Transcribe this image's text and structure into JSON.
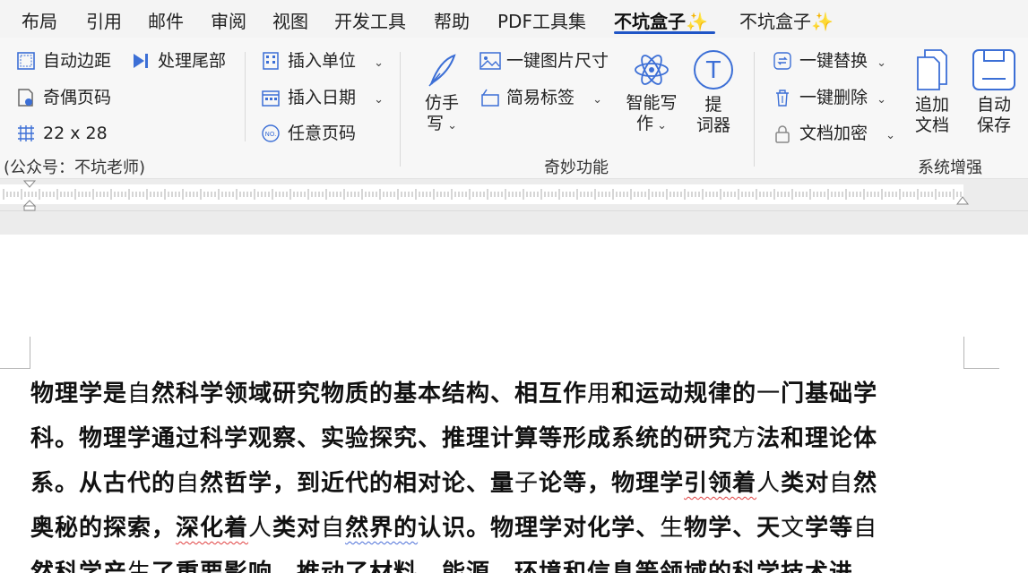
{
  "menu": {
    "items": [
      {
        "label": "布局"
      },
      {
        "label": "引用"
      },
      {
        "label": "邮件"
      },
      {
        "label": "审阅"
      },
      {
        "label": "视图"
      },
      {
        "label": "开发工具"
      },
      {
        "label": "帮助"
      },
      {
        "label": "PDF工具集"
      },
      {
        "label": "不坑盒子✨"
      },
      {
        "label": "不坑盒子✨"
      }
    ],
    "active_index": 8
  },
  "ribbon": {
    "group1": {
      "margins_label": "自动边距",
      "tail_label": "处理尾部",
      "odd_even_label": "奇偶页码",
      "grid_label": "22 x 28",
      "footer_note": "(公众号：不坑老师)"
    },
    "group2": {
      "insert_unit_label": "插入单位",
      "insert_date_label": "插入日期",
      "any_page_label": "任意页码"
    },
    "group3": {
      "handwrite_label_1": "仿手",
      "handwrite_label_2": "写",
      "img_size_label": "一键图片尺寸",
      "simple_tag_label": "简易标签",
      "smart_write_label_1": "智能写",
      "smart_write_label_2": "作",
      "prompter_label_1": "提",
      "prompter_label_2": "词器",
      "group_label": "奇妙功能"
    },
    "group4": {
      "replace_label": "一键替换",
      "delete_label": "一键删除",
      "encrypt_label": "文档加密",
      "append_label_1": "追加",
      "append_label_2": "文档",
      "autosave_label_1": "自动",
      "autosave_label_2": "保存",
      "group_label": "系统增强"
    }
  },
  "document": {
    "lines": [
      [
        "物理学是",
        "自",
        "然科学领域研究物质的基本结构、相互作",
        "用",
        "和运动规律的",
        "一",
        "门基础学"
      ],
      [
        "科。物理学通过科学观察、实验探究、推理计算等形成系统的研究",
        "方",
        "法和理论体"
      ],
      [
        "系。从古代的",
        "自",
        "然哲学，到近代的相对论、量",
        "子",
        "论等，物理学",
        "引领着",
        "",
        "人",
        "类对",
        "自",
        "然"
      ],
      [
        "奥秘的探索，",
        "深化着",
        "",
        "人",
        "类对",
        "自",
        "",
        "然界的",
        "认识。物理学对化学、",
        "生",
        "物学、天",
        "文",
        "学等",
        "自"
      ],
      [
        "然科学产",
        "生",
        "了重要影响，推动了材料、能源、环境和信息等领域的科学技术进"
      ]
    ]
  },
  "colors": {
    "accent": "#1f55c6",
    "ribbon_bg": "#f7f7f7",
    "icon_blue": "#3c6fd6"
  }
}
